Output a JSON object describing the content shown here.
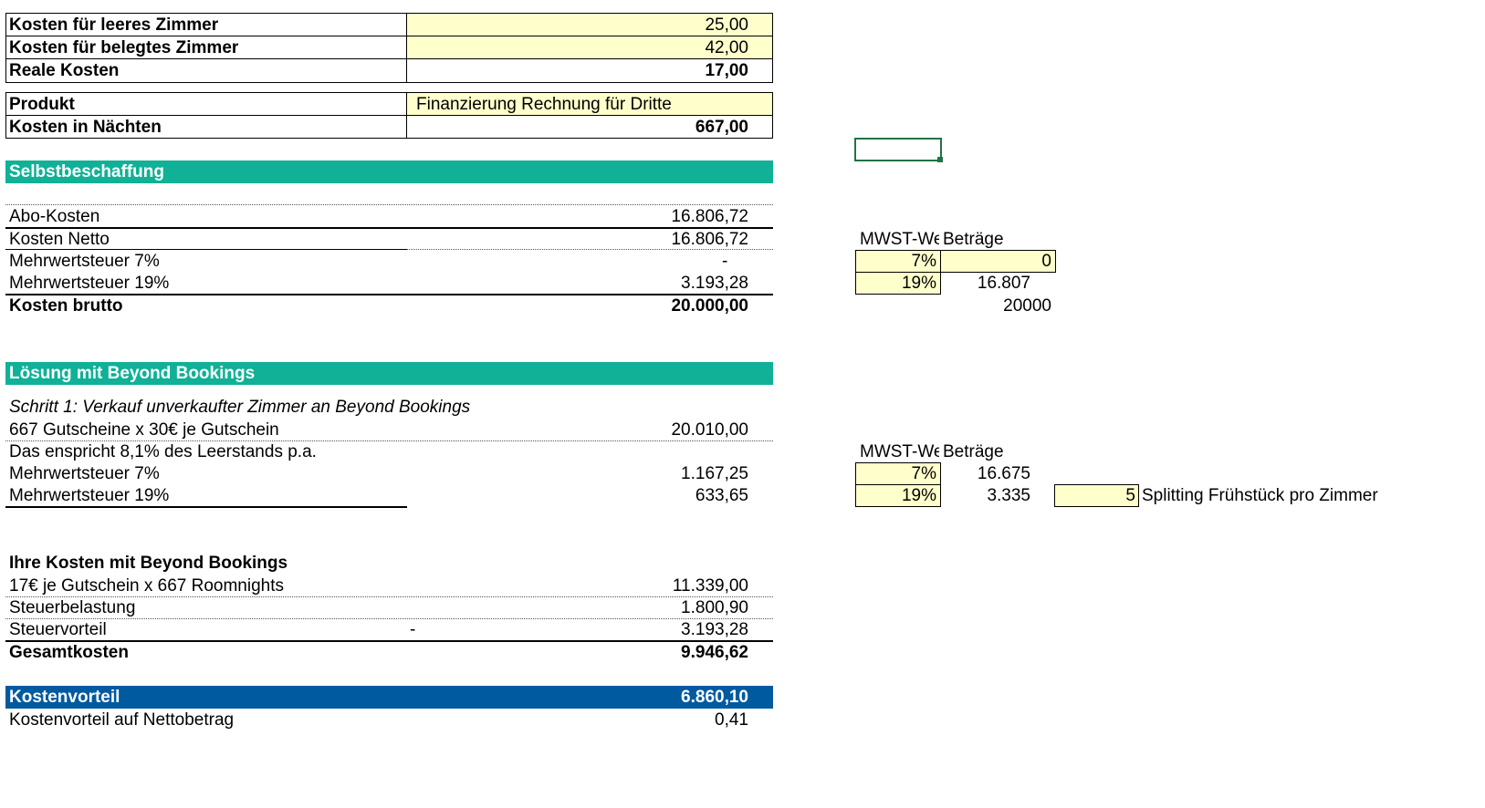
{
  "top_table": {
    "rows": [
      {
        "label": "Kosten für leeres Zimmer",
        "value": "25,00"
      },
      {
        "label": "Kosten für belegtes Zimmer",
        "value": "42,00"
      },
      {
        "label": "Reale Kosten",
        "value": "17,00"
      }
    ]
  },
  "product_table": {
    "product_label": "Produkt",
    "product_value": "Finanzierung Rechnung für Dritte",
    "nights_label": "Kosten in Nächten",
    "nights_value": "667,00"
  },
  "section1": {
    "title": "Selbstbeschaffung",
    "rows": [
      {
        "label": "Abo-Kosten",
        "value": "16.806,72"
      },
      {
        "label": "Kosten Netto",
        "value": "16.806,72"
      },
      {
        "label": "Mehrwertsteuer 7%",
        "value": "-"
      },
      {
        "label": "Mehrwertsteuer 19%",
        "value": "3.193,28"
      }
    ],
    "total_label": "Kosten brutto",
    "total_value": "20.000,00"
  },
  "side1": {
    "header_a": "MWST-We",
    "header_b": "Beträge",
    "rate1": "7%",
    "amount1": "0",
    "rate2": "19%",
    "amount2": "16.807",
    "total": "20000"
  },
  "section2": {
    "title": "Lösung mit Beyond Bookings",
    "step": "Schritt 1: Verkauf unverkaufter Zimmer an Beyond Bookings",
    "rows": [
      {
        "label": "667 Gutscheine x 30€ je Gutschein",
        "value": "20.010,00"
      },
      {
        "label": "Das enspricht 8,1% des Leerstands p.a.",
        "value": ""
      },
      {
        "label": "Mehrwertsteuer 7%",
        "value": "1.167,25"
      },
      {
        "label": "Mehrwertsteuer 19%",
        "value": "633,65"
      }
    ]
  },
  "side2": {
    "header_a": "MWST-We",
    "header_b": "Beträge",
    "rate1": "7%",
    "amount1": "16.675",
    "rate2": "19%",
    "amount2": "3.335",
    "splitting_value": "5",
    "splitting_label": "Splitting Frühstück pro Zimmer"
  },
  "section3": {
    "title": "Ihre Kosten mit Beyond Bookings",
    "rows": [
      {
        "label": "17€ je Gutschein x 667 Roomnights",
        "mid": "",
        "value": "11.339,00"
      },
      {
        "label": "Steuerbelastung",
        "mid": "",
        "value": "1.800,90"
      },
      {
        "label": "Steuervorteil",
        "mid": "-",
        "value": "3.193,28"
      }
    ],
    "total_label": "Gesamtkosten",
    "total_value": "9.946,62"
  },
  "result": {
    "label": "Kostenvorteil",
    "value": "6.860,10",
    "net_label": "Kostenvorteil auf Nettobetrag",
    "net_value": "0,41"
  },
  "colors": {
    "teal": "#10b196",
    "blue": "#005aa0",
    "input_yellow": "#ffffcc",
    "selection_green": "#217346"
  }
}
